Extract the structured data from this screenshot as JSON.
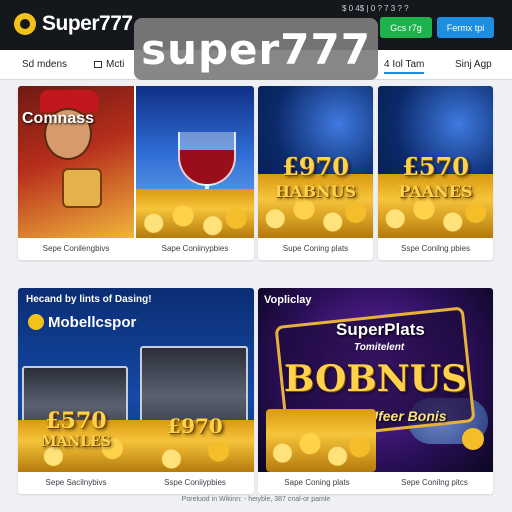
{
  "header": {
    "logo_text": "Super777",
    "user_info": "$ 0 4$ | 0 ? 7 3 ? ?",
    "login_label": "Gcs r7g",
    "signup_label": "Fermx tpi"
  },
  "watermark": "super777",
  "nav": {
    "items": [
      {
        "label": "Sd mdens"
      },
      {
        "label": "Mcti"
      },
      {
        "label": "4 Iol Tam"
      },
      {
        "label": "Sinj Agp"
      }
    ]
  },
  "cards": [
    {
      "title": "Comnass",
      "top_text": "",
      "caption": "Sepe Conilengbivs"
    },
    {
      "title": "",
      "caption": "Sape Coniinypbies"
    },
    {
      "amount": "£970",
      "label": "HABNUS",
      "caption": "Supe Coning plats"
    },
    {
      "amount": "£570",
      "label": "PAANES",
      "caption": "Sspe Conilng pbies"
    },
    {
      "header_line": "Hecand by lints of Dasing!",
      "brand": "Mobellcspor",
      "amount": "£570",
      "label": "MANLES",
      "caption": "Sepe Sacilnybivs"
    },
    {
      "amount": "£970",
      "caption": "Sspe Coniiypbies"
    },
    {
      "header_line": "Vopliclay",
      "title": "SuperPlats",
      "subtitle": "Tomitelent",
      "label": "BOBNUS",
      "sub_label": "Ufeer Bonis",
      "caption": "Sape Coning plats"
    },
    {
      "caption": "Sepe Conilng pitcs"
    }
  ],
  "footer": "Poreluod in Wikinn: - heiyble, 387 cnal-or pamle",
  "colors": {
    "header_bg": "#14171c",
    "accent_blue": "#1e8fe0",
    "accent_green": "#1fb24c",
    "gold": "#ffd24a"
  }
}
